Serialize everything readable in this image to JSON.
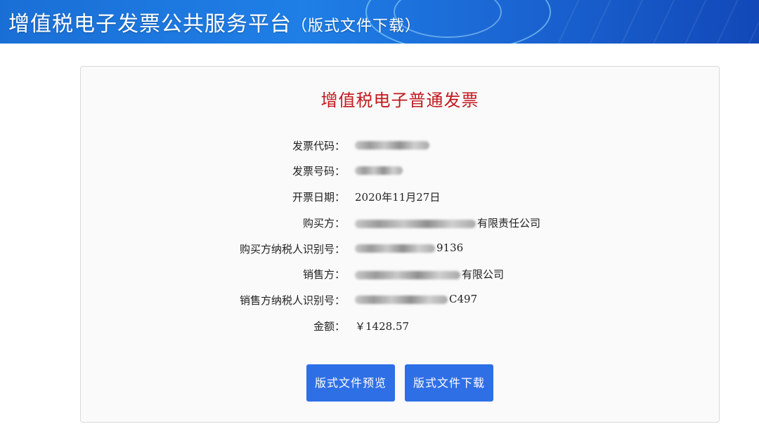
{
  "header": {
    "title": "增值税电子发票公共服务平台",
    "subtitle": "（版式文件下载）"
  },
  "invoice": {
    "title": "增值税电子普通发票",
    "fields": [
      {
        "label": "发票代码：",
        "value": ""
      },
      {
        "label": "发票号码：",
        "value": ""
      },
      {
        "label": "开票日期：",
        "value": "2020年11月27日"
      },
      {
        "label": "购买方：",
        "value": "有限责任公司"
      },
      {
        "label": "购买方纳税人识别号：",
        "value": "9136"
      },
      {
        "label": "销售方：",
        "value": "有限公司"
      },
      {
        "label": "销售方纳税人识别号：",
        "value": "C497"
      },
      {
        "label": "金额：",
        "value": "￥1428.57"
      }
    ]
  },
  "actions": {
    "preview_label": "版式文件预览",
    "download_label": "版式文件下载"
  },
  "colors": {
    "banner": "#1f7fe6",
    "title_red": "#c2191e",
    "button_blue": "#2f6fe6"
  }
}
